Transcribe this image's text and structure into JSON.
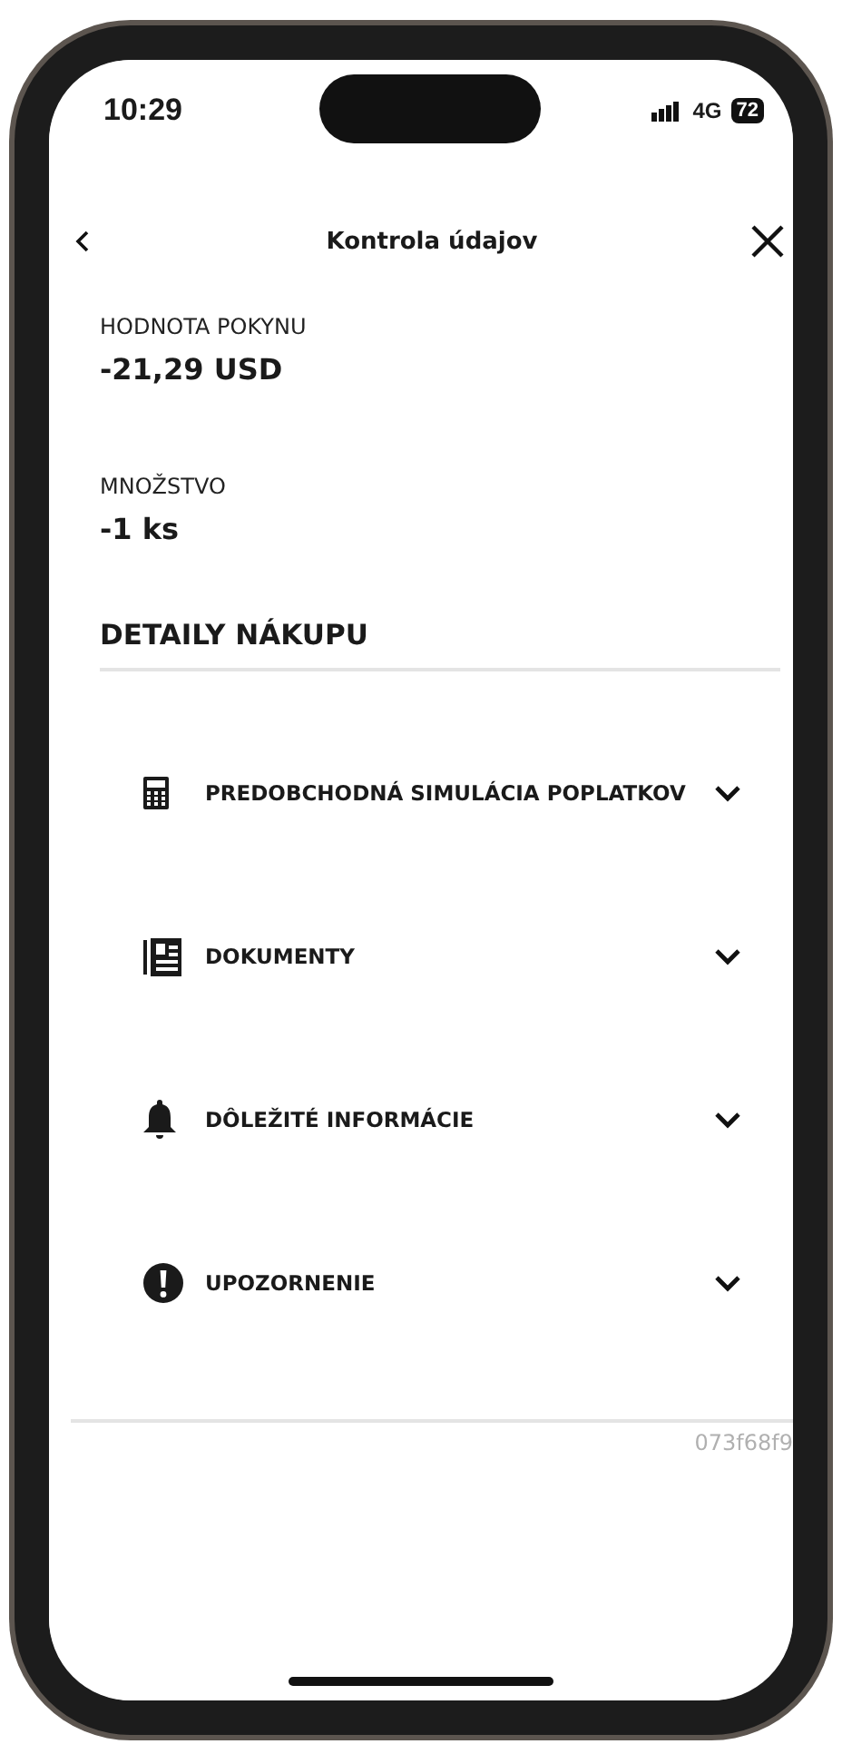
{
  "status_bar": {
    "time": "10:29",
    "network": "4G",
    "battery": "72"
  },
  "header": {
    "title": "Kontrola údajov"
  },
  "fields": [
    {
      "label": "HODNOTA POKYNU",
      "value": "-21,29 USD"
    },
    {
      "label": "MNOŽSTVO",
      "value": "-1 ks"
    }
  ],
  "section": {
    "title": "DETAILY NÁKUPU"
  },
  "accordion": [
    {
      "kind": "calculator",
      "label": "PREDOBCHODNÁ SIMULÁCIA POPLATKOV",
      "expanded": false
    },
    {
      "kind": "document",
      "label": "DOKUMENTY",
      "expanded": false
    },
    {
      "kind": "bell",
      "label": "DÔLEŽITÉ INFORMÁCIE",
      "expanded": false
    },
    {
      "kind": "alert",
      "label": "UPOZORNENIE",
      "expanded": false
    }
  ],
  "reference_code": "073f68f9"
}
